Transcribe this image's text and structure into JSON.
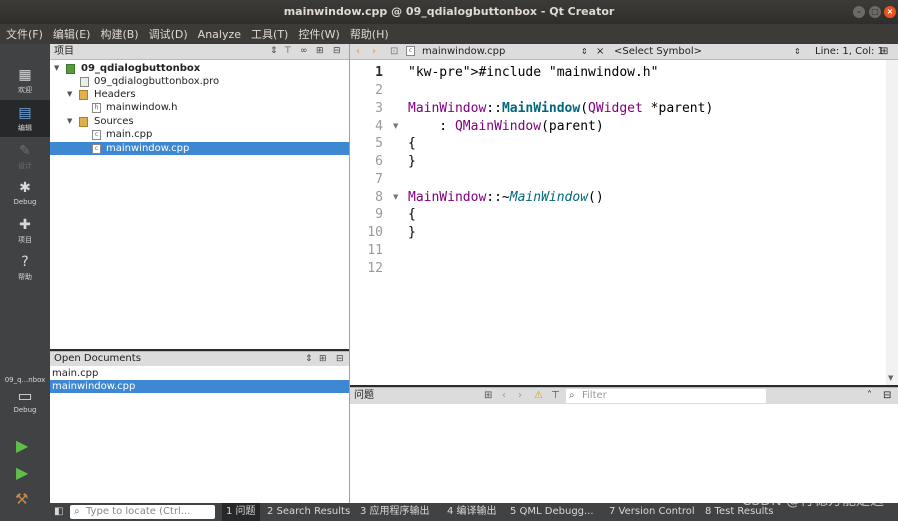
{
  "window": {
    "title": "mainwindow.cpp @ 09_qdialogbuttonbox - Qt Creator"
  },
  "menu": [
    "文件(F)",
    "编辑(E)",
    "构建(B)",
    "调试(D)",
    "Analyze",
    "工具(T)",
    "控件(W)",
    "帮助(H)"
  ],
  "modes": [
    {
      "label": "欢迎",
      "icon": "grid-icon"
    },
    {
      "label": "编辑",
      "icon": "edit-icon"
    },
    {
      "label": "设计",
      "icon": "pen-icon"
    },
    {
      "label": "Debug",
      "icon": "bug-icon"
    },
    {
      "label": "项目",
      "icon": "wrench-icon"
    },
    {
      "label": "帮助",
      "icon": "help-icon"
    }
  ],
  "kit": {
    "project": "09_q...nbox",
    "config": "Debug"
  },
  "project_panel": {
    "title": "项目",
    "tree": [
      {
        "label": "09_qdialogbuttonbox",
        "level": 0,
        "type": "project"
      },
      {
        "label": "09_qdialogbuttonbox.pro",
        "level": 1,
        "type": "pro"
      },
      {
        "label": "Headers",
        "level": 1,
        "type": "folder"
      },
      {
        "label": "mainwindow.h",
        "level": 2,
        "type": "header"
      },
      {
        "label": "Sources",
        "level": 1,
        "type": "folder"
      },
      {
        "label": "main.cpp",
        "level": 2,
        "type": "source"
      },
      {
        "label": "mainwindow.cpp",
        "level": 2,
        "type": "source",
        "selected": true
      }
    ]
  },
  "open_documents": {
    "title": "Open Documents",
    "items": [
      {
        "label": "main.cpp"
      },
      {
        "label": "mainwindow.cpp",
        "selected": true
      }
    ]
  },
  "editor": {
    "file": "mainwindow.cpp",
    "symbol": "<Select Symbol>",
    "position": "Line: 1, Col: 1",
    "line_numbers": [
      "1",
      "2",
      "3",
      "4",
      "5",
      "6",
      "7",
      "8",
      "9",
      "10",
      "11",
      "12"
    ],
    "lines": [
      "#include \"mainwindow.h\"",
      "",
      "MainWindow::MainWindow(QWidget *parent)",
      "    : QMainWindow(parent)",
      "{",
      "}",
      "",
      "MainWindow::~MainWindow()",
      "{",
      "}",
      "",
      ""
    ]
  },
  "issues": {
    "title": "问题",
    "filter_placeholder": "Filter"
  },
  "statusbar": {
    "locator_placeholder": "Type to locate (Ctrl...",
    "tabs": [
      "1 问题",
      "2 Search Results",
      "3 应用程序输出",
      "4 编译输出",
      "5 QML Debugg...",
      "7 Version Control",
      "8 Test Results"
    ]
  },
  "watermark": "CSDN @行稳方能走远"
}
